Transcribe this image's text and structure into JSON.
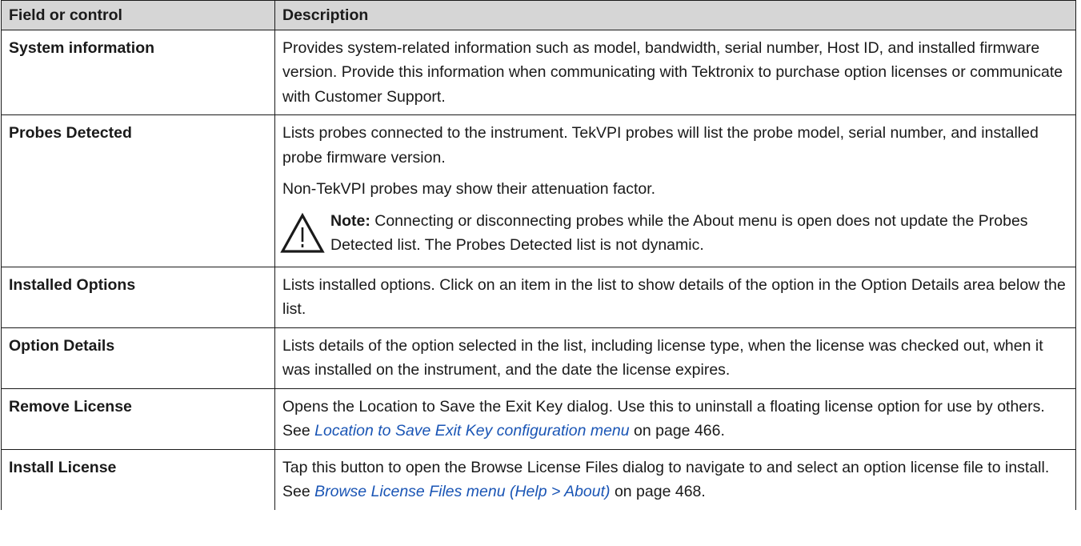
{
  "table": {
    "headers": [
      "Field or control",
      "Description"
    ],
    "rows": [
      {
        "field": "System information",
        "description": "Provides system-related information such as model, bandwidth, serial number, Host ID, and installed firmware version. Provide this information when communicating with Tektronix to purchase option licenses or communicate with Customer Support."
      },
      {
        "field": "Probes Detected",
        "description": "Lists probes connected to the instrument. TekVPI probes will list the probe model, serial number, and installed probe firmware version.",
        "description2": "Non-TekVPI probes may show their attenuation factor.",
        "note_label": "Note:",
        "note_text": "Connecting or disconnecting probes while the About menu is open does not update the Probes Detected list. The Probes Detected list is not dynamic.",
        "note_icon": "warning-triangle-icon"
      },
      {
        "field": "Installed Options",
        "description": "Lists installed options. Click on an item in the list to show details of the option in the Option Details area below the list."
      },
      {
        "field": "Option Details",
        "description": "Lists details of the option selected in the list, including license type, when the license was checked out, when it was installed on the instrument, and the date the license expires."
      },
      {
        "field": "Remove License",
        "description_pre": "Opens the Location to Save the Exit Key dialog. Use this to uninstall a floating license option for use by others. See ",
        "link_text": "Location to Save Exit Key configuration menu",
        "description_post": " on page 466."
      },
      {
        "field": "Install License",
        "description_pre": "Tap this button to open the Browse License Files dialog to navigate to and select an option license file to install. See ",
        "link_text": "Browse License Files menu (Help > About)",
        "description_post": " on page 468."
      }
    ]
  },
  "colors": {
    "header_background": "#d6d6d6",
    "border": "#1a1a1a",
    "link": "#1a55b5"
  }
}
